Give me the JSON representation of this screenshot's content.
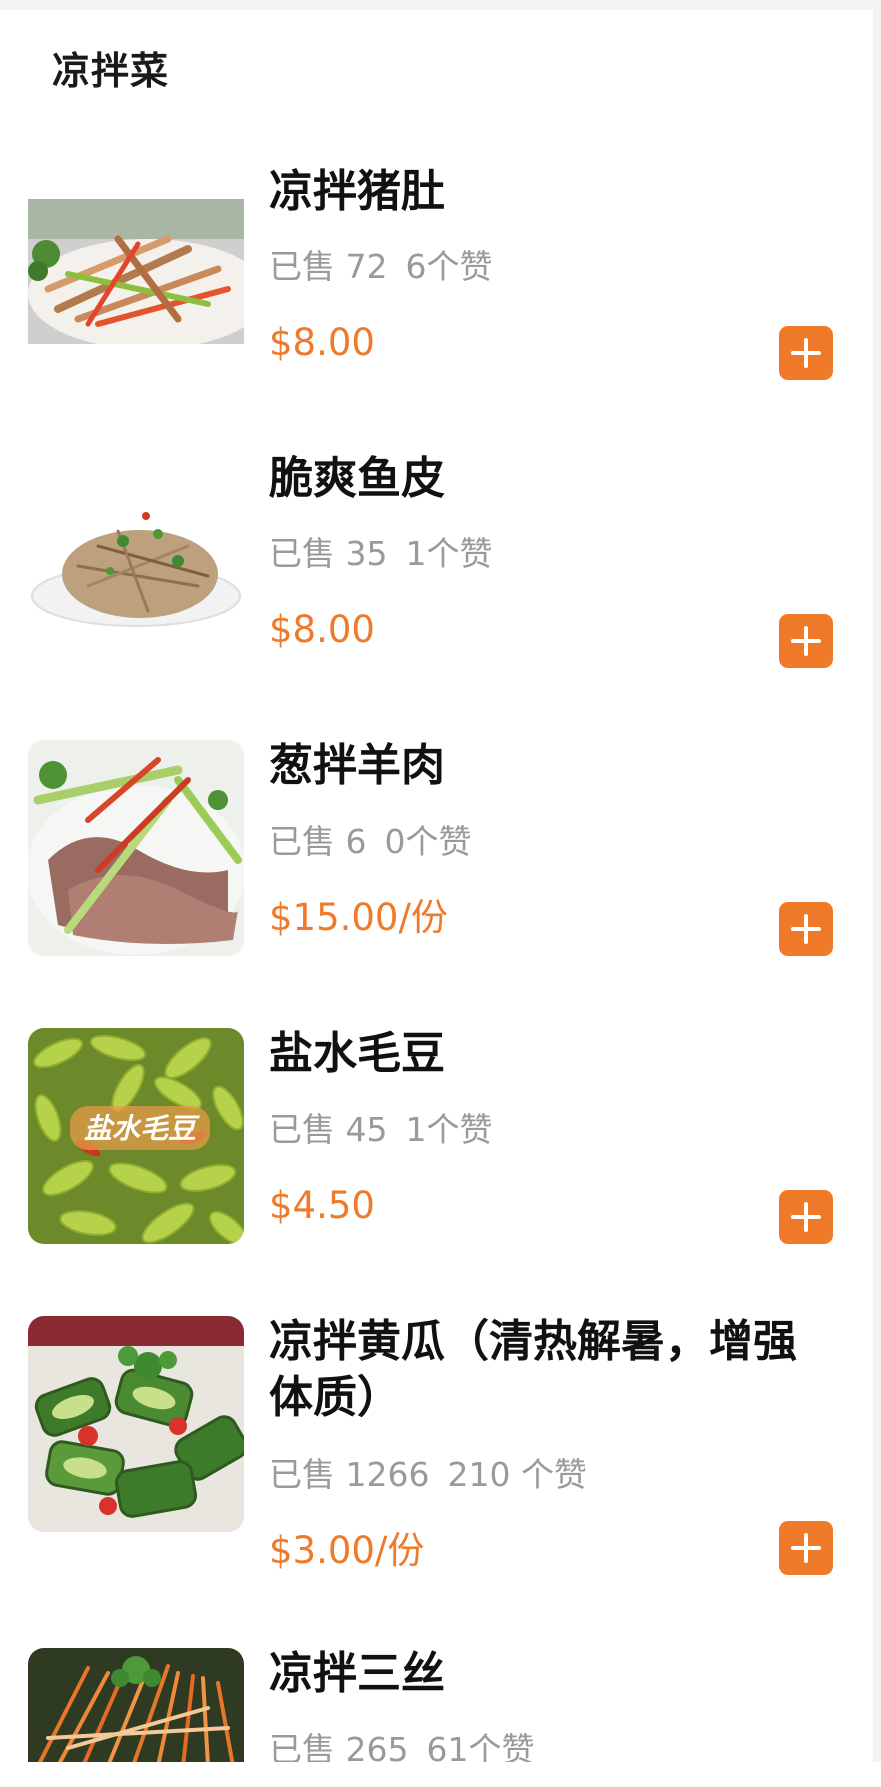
{
  "category": {
    "title": "凉拌菜"
  },
  "items": [
    {
      "name": "凉拌猪肚",
      "sold": "已售 72",
      "likes": "6个赞",
      "price": "$8.00",
      "image": "shredded-tripe-salad"
    },
    {
      "name": "脆爽鱼皮",
      "sold": "已售 35",
      "likes": "1个赞",
      "price": "$8.00",
      "image": "crispy-fish-skin"
    },
    {
      "name": "葱拌羊肉",
      "sold": "已售 6",
      "likes": "0个赞",
      "price": "$15.00/份",
      "image": "lamb-with-scallion"
    },
    {
      "name": "盐水毛豆",
      "sold": "已售 45",
      "likes": "1个赞",
      "price": "$4.50",
      "image": "salted-edamame",
      "image_caption": "盐水毛豆"
    },
    {
      "name": "凉拌黄瓜（清热解暑，增强体质）",
      "sold": "已售 1266",
      "likes": "210 个赞",
      "price": "$3.00/份",
      "image": "smashed-cucumber"
    },
    {
      "name": "凉拌三丝",
      "sold": "已售 265",
      "likes": "61个赞",
      "price": "",
      "image": "three-shreds-salad"
    }
  ],
  "colors": {
    "accent": "#ee7a2a",
    "meta_text": "#9a9a9a",
    "title_text": "#111111"
  },
  "icons": {
    "add": "plus-icon"
  }
}
